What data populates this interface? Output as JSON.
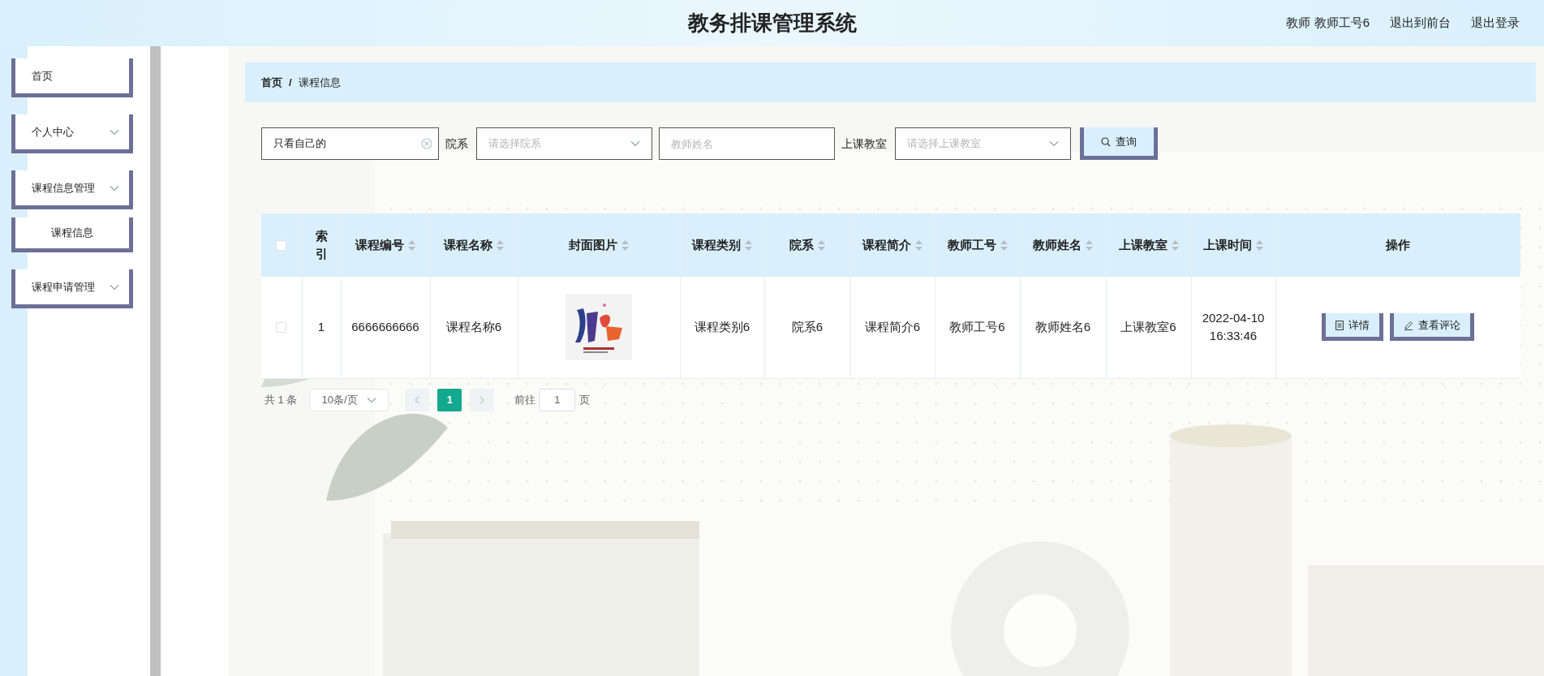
{
  "header": {
    "title": "教务排课管理系统",
    "user": "教师 教师工号6",
    "links": [
      {
        "label": "退出到前台"
      },
      {
        "label": "退出登录"
      }
    ]
  },
  "sidebar": {
    "items": [
      {
        "label": "首页",
        "kind": "link"
      },
      {
        "label": "个人中心",
        "kind": "group"
      },
      {
        "label": "课程信息管理",
        "kind": "group",
        "children": [
          {
            "label": "课程信息"
          }
        ]
      },
      {
        "label": "课程申请管理",
        "kind": "group"
      }
    ]
  },
  "breadcrumb": {
    "separator": "/",
    "items": [
      {
        "label": "首页"
      },
      {
        "label": "课程信息"
      }
    ]
  },
  "filters": [
    {
      "kind": "input",
      "value": "只看自己的",
      "clearable": true
    },
    {
      "kind": "select",
      "label": "院系",
      "placeholder": "请选择院系"
    },
    {
      "kind": "input",
      "placeholder": "教师姓名",
      "clearable": false
    },
    {
      "kind": "select",
      "label": "上课教室",
      "placeholder": "请选择上课教室"
    }
  ],
  "search_button": {
    "label": "查询"
  },
  "table": {
    "select_all": {
      "checked": false
    },
    "columns": [
      {
        "label": "索引",
        "sortable": false
      },
      {
        "label": "课程编号",
        "sortable": true
      },
      {
        "label": "课程名称",
        "sortable": true
      },
      {
        "label": "封面图片",
        "sortable": true
      },
      {
        "label": "课程类别",
        "sortable": true
      },
      {
        "label": "院系",
        "sortable": true
      },
      {
        "label": "课程简介",
        "sortable": true
      },
      {
        "label": "教师工号",
        "sortable": true
      },
      {
        "label": "教师姓名",
        "sortable": true
      },
      {
        "label": "上课教室",
        "sortable": true
      },
      {
        "label": "上课时间",
        "sortable": true
      },
      {
        "label": "操作",
        "sortable": false
      }
    ],
    "rows": [
      {
        "checked": false,
        "cells": [
          {
            "kind": "text",
            "text": "1"
          },
          {
            "kind": "text",
            "text": "6666666666"
          },
          {
            "kind": "text",
            "text": "课程名称6"
          },
          {
            "kind": "picture"
          },
          {
            "kind": "text",
            "text": "课程类别6"
          },
          {
            "kind": "text",
            "text": "院系6"
          },
          {
            "kind": "text",
            "text": "课程简介6"
          },
          {
            "kind": "text",
            "text": "教师工号6"
          },
          {
            "kind": "text",
            "text": "教师姓名6"
          },
          {
            "kind": "text",
            "text": "上课教室6"
          },
          {
            "kind": "text",
            "text": "2022-04-10 16:33:46"
          }
        ],
        "actions": [
          {
            "kind": "detail",
            "label": "详情"
          },
          {
            "kind": "comments",
            "label": "查看评论"
          }
        ]
      }
    ]
  },
  "pagination": {
    "total": "共 1 条",
    "page_size": "10条/页",
    "pages": [
      {
        "label": "1",
        "selected": true
      }
    ],
    "goto_label": "前往",
    "goto_value": "1",
    "goto_suffix": "页"
  }
}
